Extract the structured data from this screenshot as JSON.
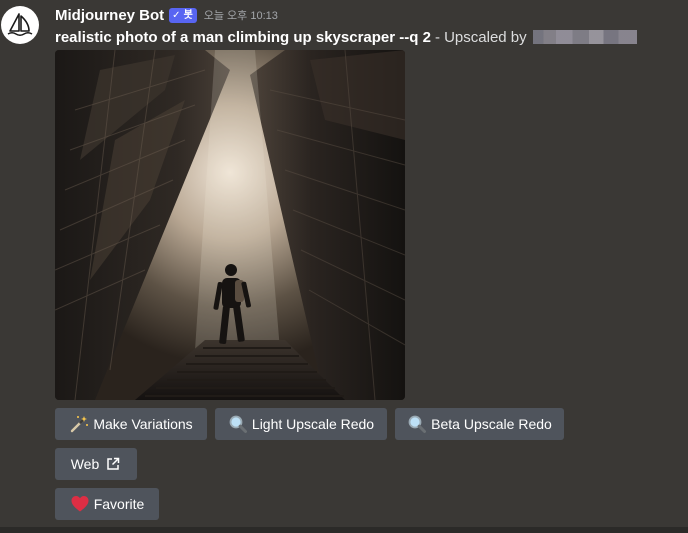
{
  "message": {
    "author": "Midjourney Bot",
    "bot_tag": "봇",
    "bot_check": "✓",
    "timestamp": "오늘 오후 10:13",
    "prompt": "realistic photo of a man climbing up skyscraper --q 2",
    "suffix": "- Upscaled by"
  },
  "buttons": {
    "make_variations": "Make Variations",
    "light_upscale_redo": "Light Upscale Redo",
    "beta_upscale_redo": "Beta Upscale Redo",
    "web": "Web",
    "favorite": "Favorite"
  },
  "icons": {
    "avatar": "sailboat-icon",
    "make_variations": "magic-wand-icon",
    "light_upscale_redo": "magnifier-icon",
    "beta_upscale_redo": "magnifier-icon",
    "web": "external-link-icon",
    "favorite": "heart-icon"
  },
  "colors": {
    "background": "#3a3835",
    "button": "#4f545c",
    "bot_tag": "#5865f2",
    "heart": "#dd2e44"
  }
}
